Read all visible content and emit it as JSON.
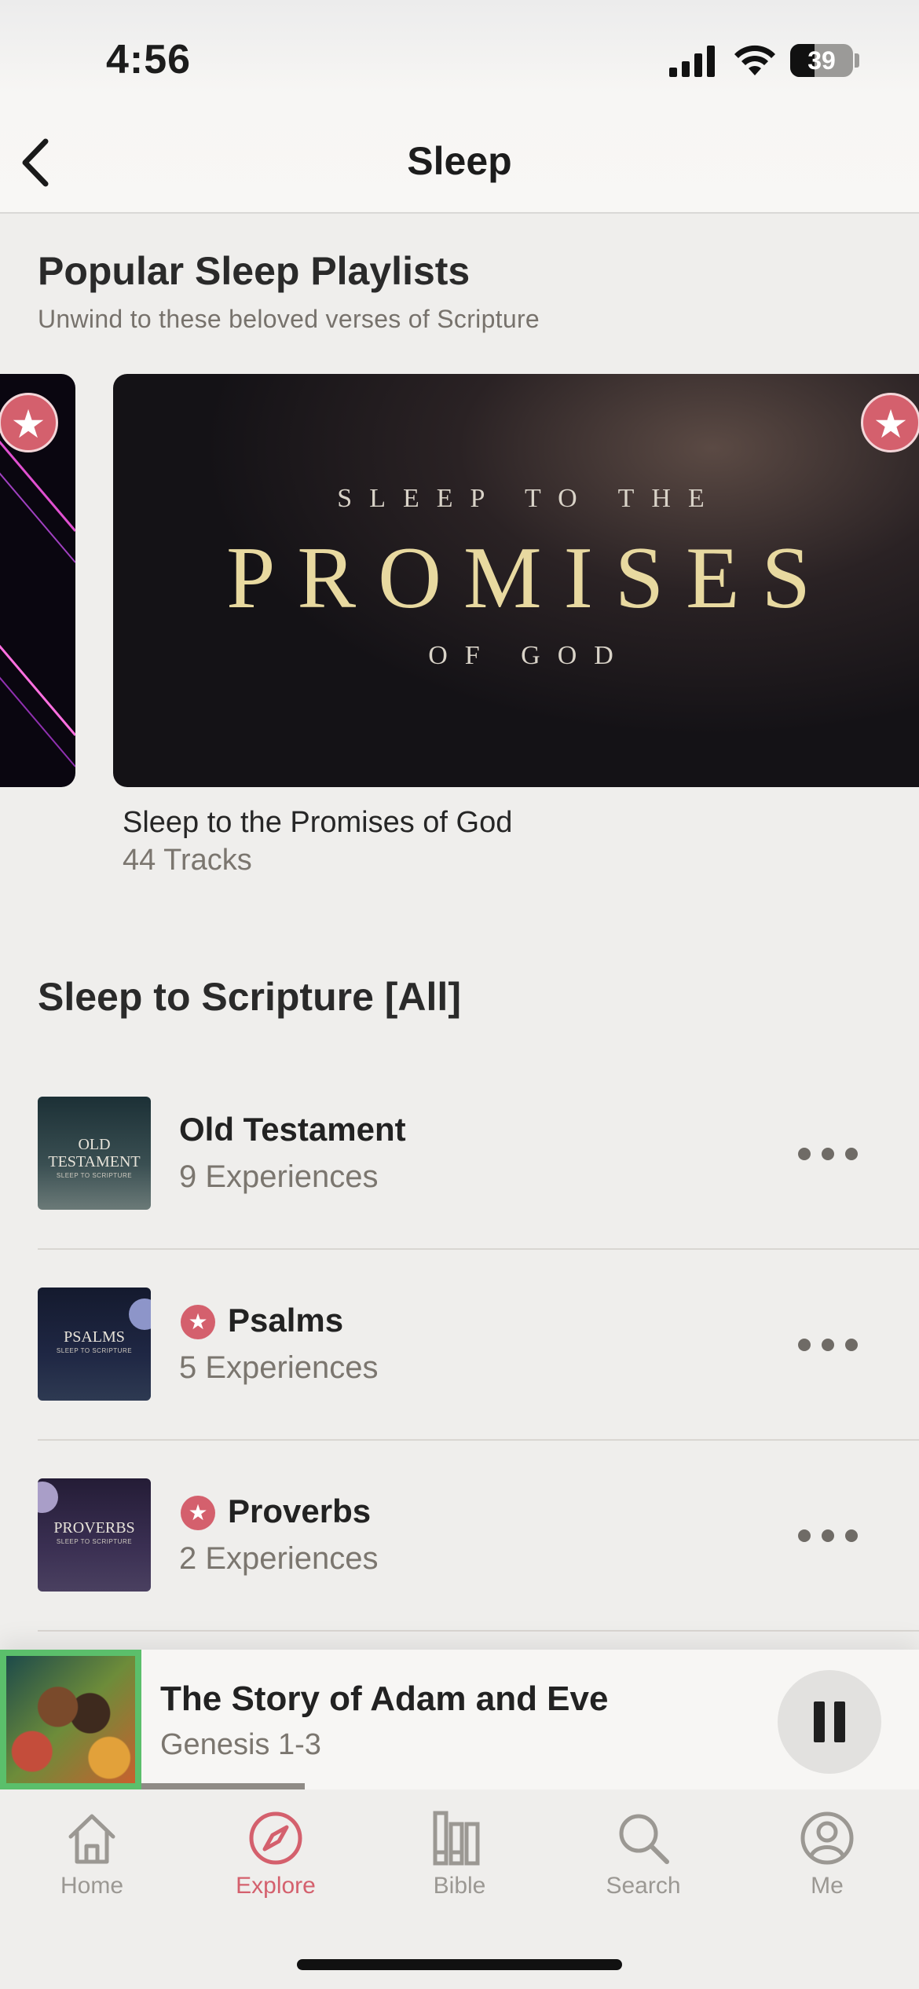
{
  "status_bar": {
    "time": "4:56",
    "battery": "39"
  },
  "nav": {
    "title": "Sleep"
  },
  "popular": {
    "title": "Popular Sleep Playlists",
    "subtitle": "Unwind to these beloved verses of Scripture",
    "featured": {
      "cover_top": "SLEEP TO THE",
      "cover_main": "PROMISES",
      "cover_bottom": "OF GOD",
      "title": "Sleep to the Promises of God",
      "tracks": "44 Tracks"
    }
  },
  "list": {
    "title": "Sleep to Scripture [All]",
    "items": [
      {
        "title": "Old Testament",
        "subtitle": "9 Experiences",
        "thumb_label": "OLD TESTAMENT",
        "thumb_sub": "SLEEP TO SCRIPTURE",
        "premium": false
      },
      {
        "title": "Psalms",
        "subtitle": "5 Experiences",
        "thumb_label": "PSALMS",
        "thumb_sub": "SLEEP TO SCRIPTURE",
        "premium": true
      },
      {
        "title": "Proverbs",
        "subtitle": "2 Experiences",
        "thumb_label": "PROVERBS",
        "thumb_sub": "SLEEP TO SCRIPTURE",
        "premium": true
      }
    ]
  },
  "player": {
    "title": "The Story of Adam and Eve",
    "subtitle": "Genesis 1-3",
    "progress": 0.21
  },
  "tabs": [
    {
      "label": "Home",
      "icon": "home-icon",
      "active": false
    },
    {
      "label": "Explore",
      "icon": "compass-icon",
      "active": true
    },
    {
      "label": "Bible",
      "icon": "books-icon",
      "active": false
    },
    {
      "label": "Search",
      "icon": "search-icon",
      "active": false
    },
    {
      "label": "Me",
      "icon": "profile-icon",
      "active": false
    }
  ],
  "colors": {
    "accent": "#d4606d",
    "background": "#efeeec",
    "premium_badge": "#d4606d"
  }
}
